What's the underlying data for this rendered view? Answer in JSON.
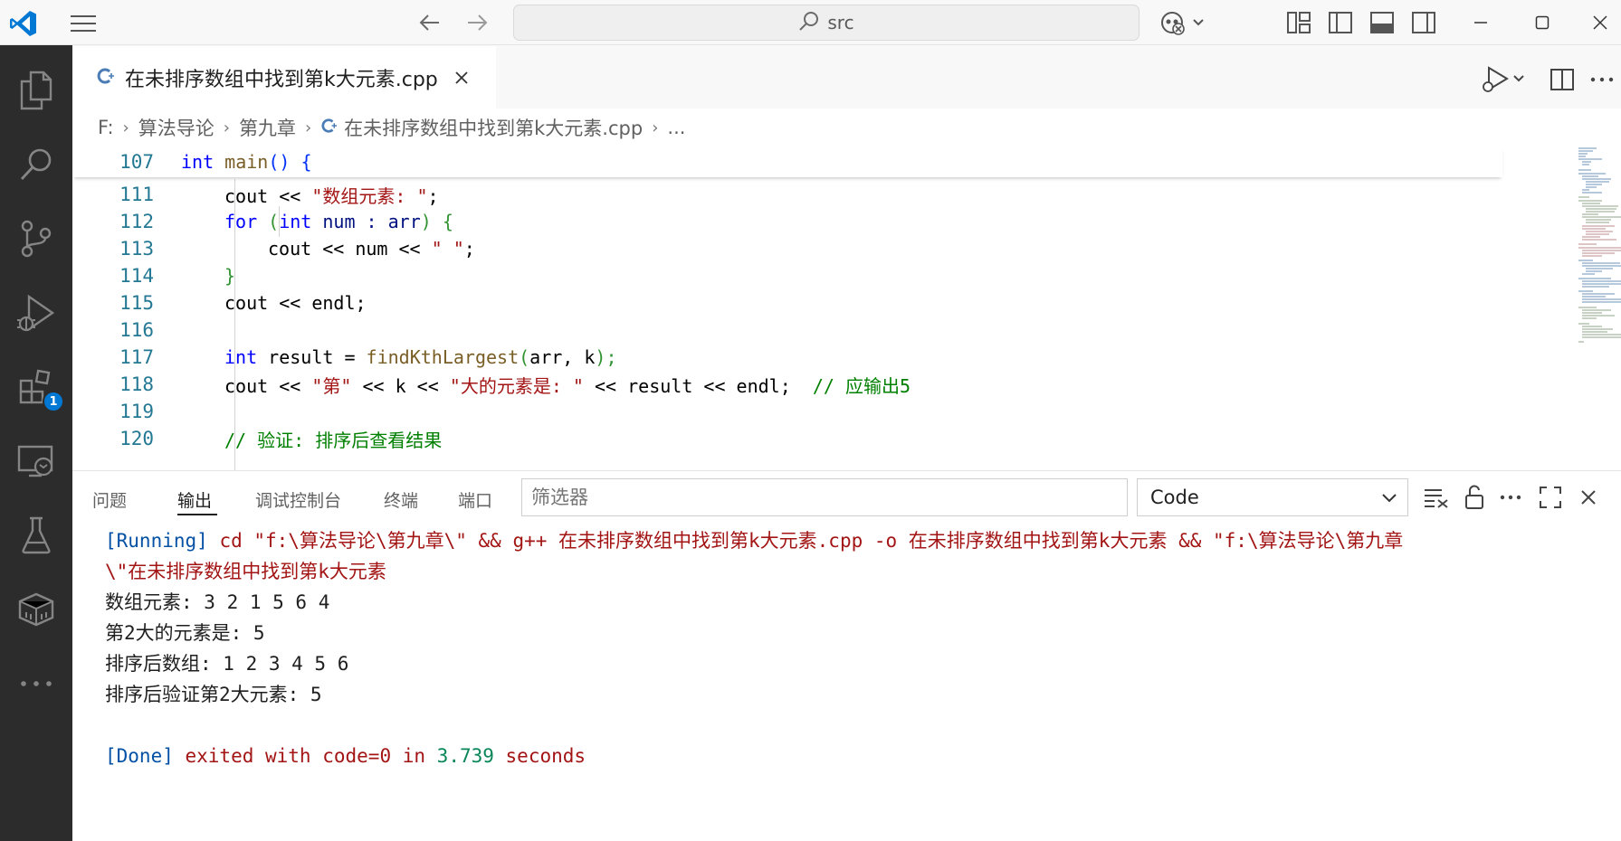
{
  "titlebar": {
    "search_text": "src",
    "icons": [
      "vscode-logo-icon",
      "hamburger-menu-icon",
      "arrow-left-icon",
      "arrow-right-icon",
      "search-icon",
      "copilot-icon",
      "customize-layout-icon",
      "toggle-sidebar-icon",
      "toggle-panel-icon",
      "toggle-secondary-sidebar-icon",
      "minimize-icon",
      "maximize-icon",
      "close-icon"
    ]
  },
  "activity_bar": {
    "items": [
      "explorer",
      "search",
      "source-control",
      "run-and-debug",
      "extensions",
      "remote-explorer",
      "testing",
      "containers",
      "more"
    ],
    "extensions_badge": "1"
  },
  "editor_tab": {
    "label": "在未排序数组中找到第k大元素.cpp"
  },
  "breadcrumb": {
    "drive": "F:",
    "folder1": "算法导论",
    "folder2": "第九章",
    "file": "在未排序数组中找到第k大元素.cpp",
    "more": "..."
  },
  "code": {
    "sticky": {
      "line": "107",
      "kw": "int",
      "fn": "main",
      "rest": "() {"
    },
    "lines": [
      {
        "n": "111",
        "a": "cout << ",
        "s": "\"数组元素: \"",
        "b": ";"
      },
      {
        "n": "112",
        "kw1": "for",
        "p1": " (",
        "kw2": "int",
        "a": " num : arr",
        "p2": ") {"
      },
      {
        "n": "113",
        "a": "cout << num << ",
        "s": "\" \"",
        "b": ";"
      },
      {
        "n": "114",
        "b": "}"
      },
      {
        "n": "115",
        "a": "cout << endl;"
      },
      {
        "n": "116"
      },
      {
        "n": "117",
        "kw": "int",
        "a": " result = ",
        "fn": "findKthLargest",
        "p1": "(",
        "args": "arr, k",
        "p2": ");"
      },
      {
        "n": "118",
        "a": "cout << ",
        "s1": "\"第\"",
        "b": " << k << ",
        "s2": "\"大的元素是: \"",
        "c": " << result << endl;  ",
        "cm": "// 应输出5"
      },
      {
        "n": "119"
      },
      {
        "n": "120",
        "cm": "// 验证: 排序后查看结果"
      }
    ]
  },
  "panel": {
    "tabs": [
      "问题",
      "输出",
      "调试控制台",
      "终端",
      "端口"
    ],
    "active_tab": "输出",
    "filter_placeholder": "筛选器",
    "channel": "Code",
    "output": {
      "running_tag": "[Running]",
      "running_cmd_1": " cd \"f:\\算法导论\\第九章\\\" && g++ 在未排序数组中找到第k大元素.cpp -o 在未排序数组中找到第k大元素 && \"f:\\算法导论\\第九章",
      "running_cmd_2": "\\\"在未排序数组中找到第k大元素",
      "line1": "数组元素: 3 2 1 5 6 4",
      "line2": "第2大的元素是: 5",
      "line3": "排序后数组: 1 2 3 4 5 6",
      "line4": "排序后验证第2大元素: 5",
      "done_tag": "[Done]",
      "done_1": " exited with ",
      "done_code": "code=0",
      "done_2": " in ",
      "done_time": "3.739",
      "done_3": " seconds"
    }
  },
  "colors": {
    "activity_bar": "#2c2c2c",
    "keyword": "#0000ff",
    "string": "#a31515",
    "comment": "#008000",
    "line_number": "#237893",
    "badge": "#0078d4"
  }
}
